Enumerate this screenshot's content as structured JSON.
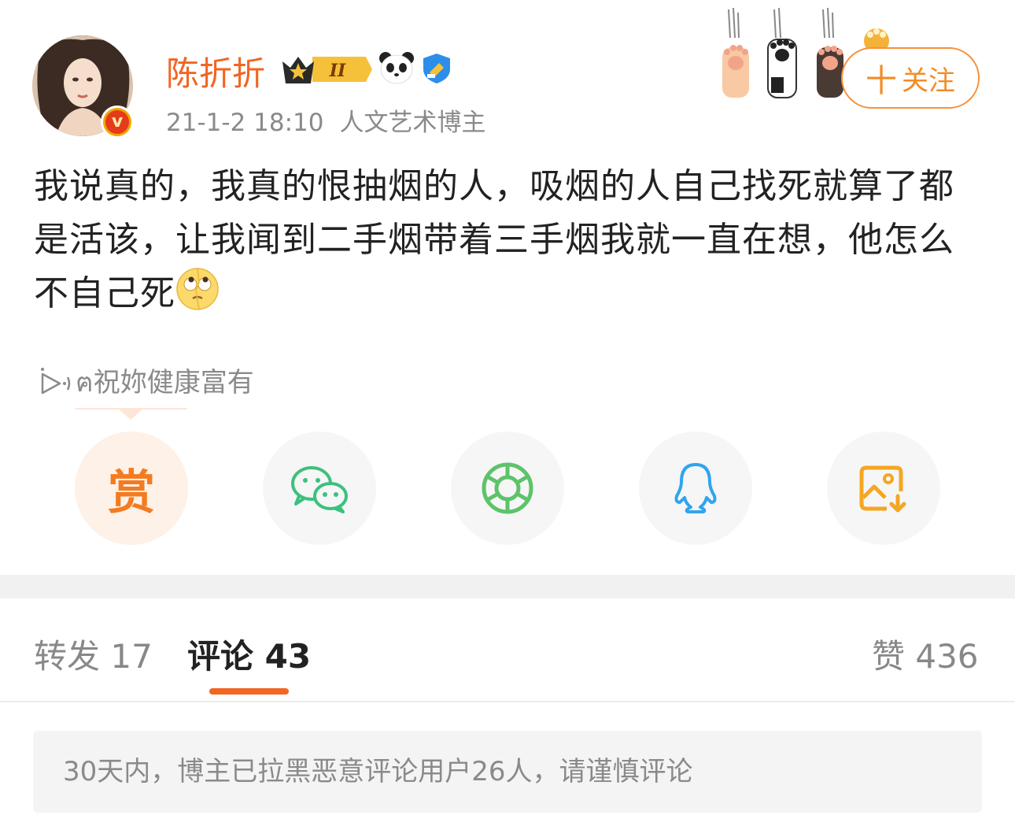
{
  "header": {
    "username": "陈折折",
    "level_badge": "II",
    "timestamp": "21-1-2 18:10",
    "user_tag": "人文艺术博主",
    "follow_label": "关注",
    "follow_plus": "十"
  },
  "post": {
    "text": "我说真的，我真的恨抽烟的人，吸烟的人自己找死就算了都是活该，让我闻到二手烟带着三手烟我就一直在想，他怎么不自己死",
    "emoji": "rolling-eyes-emoji"
  },
  "music": {
    "label": "ฅ祝妳健康富有"
  },
  "share": {
    "reward_label": "赏",
    "items": [
      "reward",
      "wechat",
      "moments",
      "qq",
      "save-image"
    ]
  },
  "tabs": {
    "repost": "转发 17",
    "comments": "评论 43",
    "likes": "赞 436"
  },
  "notice": {
    "text": "30天内，博主已拉黑恶意评论用户26人，请谨慎评论"
  },
  "colors": {
    "accent": "#f26522",
    "username": "#f26522",
    "follow_border": "#f7913a",
    "muted_text": "#8a8a8a",
    "wechat": "#3cc17d",
    "moments": "#5dc36a",
    "qq": "#2fa5ef",
    "save": "#f5a623"
  }
}
